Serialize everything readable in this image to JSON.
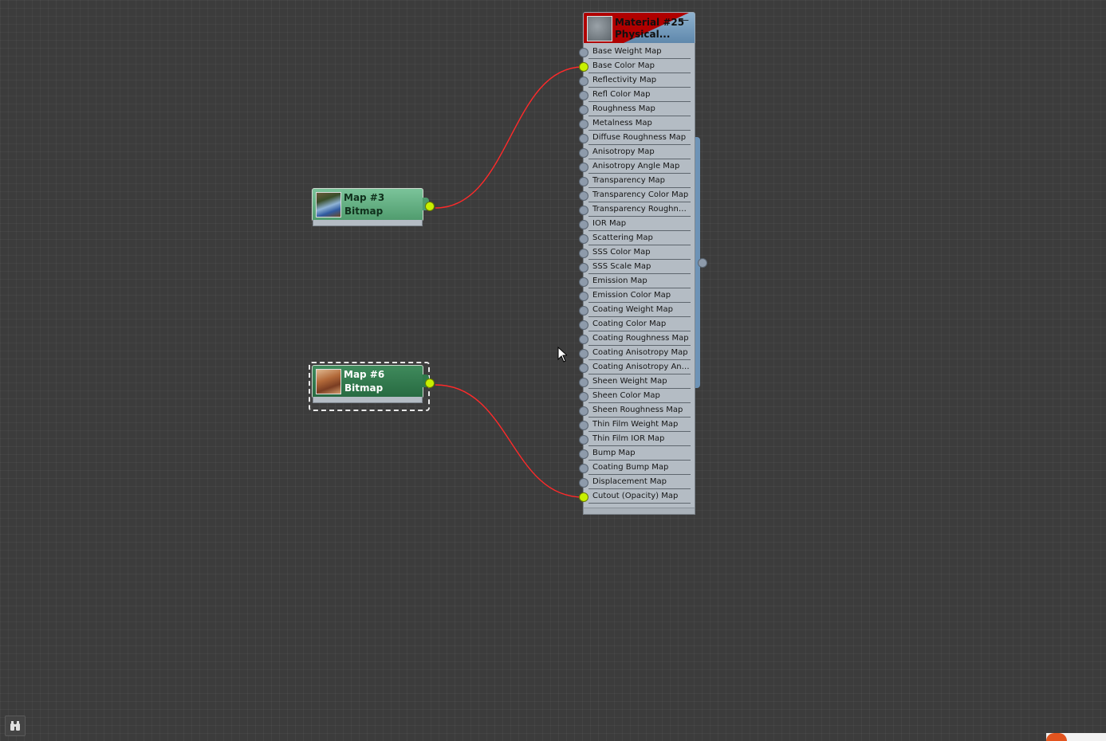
{
  "map_nodes": [
    {
      "title": "Map #3",
      "type": "Bitmap",
      "selected": false
    },
    {
      "title": "Map #6",
      "type": "Bitmap",
      "selected": true
    }
  ],
  "material": {
    "title": "Material #25",
    "type": "Physical...",
    "collapse_symbol": "—",
    "slots": [
      {
        "label": "Base Weight Map",
        "connected": false
      },
      {
        "label": "Base Color Map",
        "connected": true
      },
      {
        "label": "Reflectivity Map",
        "connected": false
      },
      {
        "label": "Refl Color Map",
        "connected": false
      },
      {
        "label": "Roughness Map",
        "connected": false
      },
      {
        "label": "Metalness Map",
        "connected": false
      },
      {
        "label": "Diffuse Roughness Map",
        "connected": false
      },
      {
        "label": "Anisotropy Map",
        "connected": false
      },
      {
        "label": "Anisotropy Angle Map",
        "connected": false
      },
      {
        "label": "Transparency Map",
        "connected": false
      },
      {
        "label": "Transparency Color Map",
        "connected": false
      },
      {
        "label": "Transparency Roughnes...",
        "connected": false
      },
      {
        "label": "IOR Map",
        "connected": false
      },
      {
        "label": "Scattering Map",
        "connected": false
      },
      {
        "label": "SSS Color Map",
        "connected": false
      },
      {
        "label": "SSS Scale Map",
        "connected": false
      },
      {
        "label": "Emission Map",
        "connected": false
      },
      {
        "label": "Emission Color Map",
        "connected": false
      },
      {
        "label": "Coating Weight Map",
        "connected": false
      },
      {
        "label": "Coating Color Map",
        "connected": false
      },
      {
        "label": "Coating Roughness Map",
        "connected": false
      },
      {
        "label": "Coating Anisotropy Map",
        "connected": false
      },
      {
        "label": "Coating Anisotropy Angle...",
        "connected": false
      },
      {
        "label": "Sheen Weight Map",
        "connected": false
      },
      {
        "label": "Sheen Color Map",
        "connected": false
      },
      {
        "label": "Sheen Roughness Map",
        "connected": false
      },
      {
        "label": "Thin Film Weight Map",
        "connected": false
      },
      {
        "label": "Thin Film IOR Map",
        "connected": false
      },
      {
        "label": "Bump Map",
        "connected": false
      },
      {
        "label": "Coating Bump Map",
        "connected": false
      },
      {
        "label": "Displacement Map",
        "connected": false
      },
      {
        "label": "Cutout (Opacity) Map",
        "connected": true
      }
    ]
  },
  "connections": [
    {
      "from": "Map #3",
      "to": "Base Color Map"
    },
    {
      "from": "Map #6",
      "to": "Cutout (Opacity) Map"
    }
  ],
  "colors": {
    "canvas": "#3c3c3c",
    "wire": "#ff2a2a",
    "socket_active": "#c8f000",
    "material_header": "#6f98bc",
    "material_warning": "#b00000"
  },
  "icons": {
    "navigator": "binoculars-icon"
  }
}
